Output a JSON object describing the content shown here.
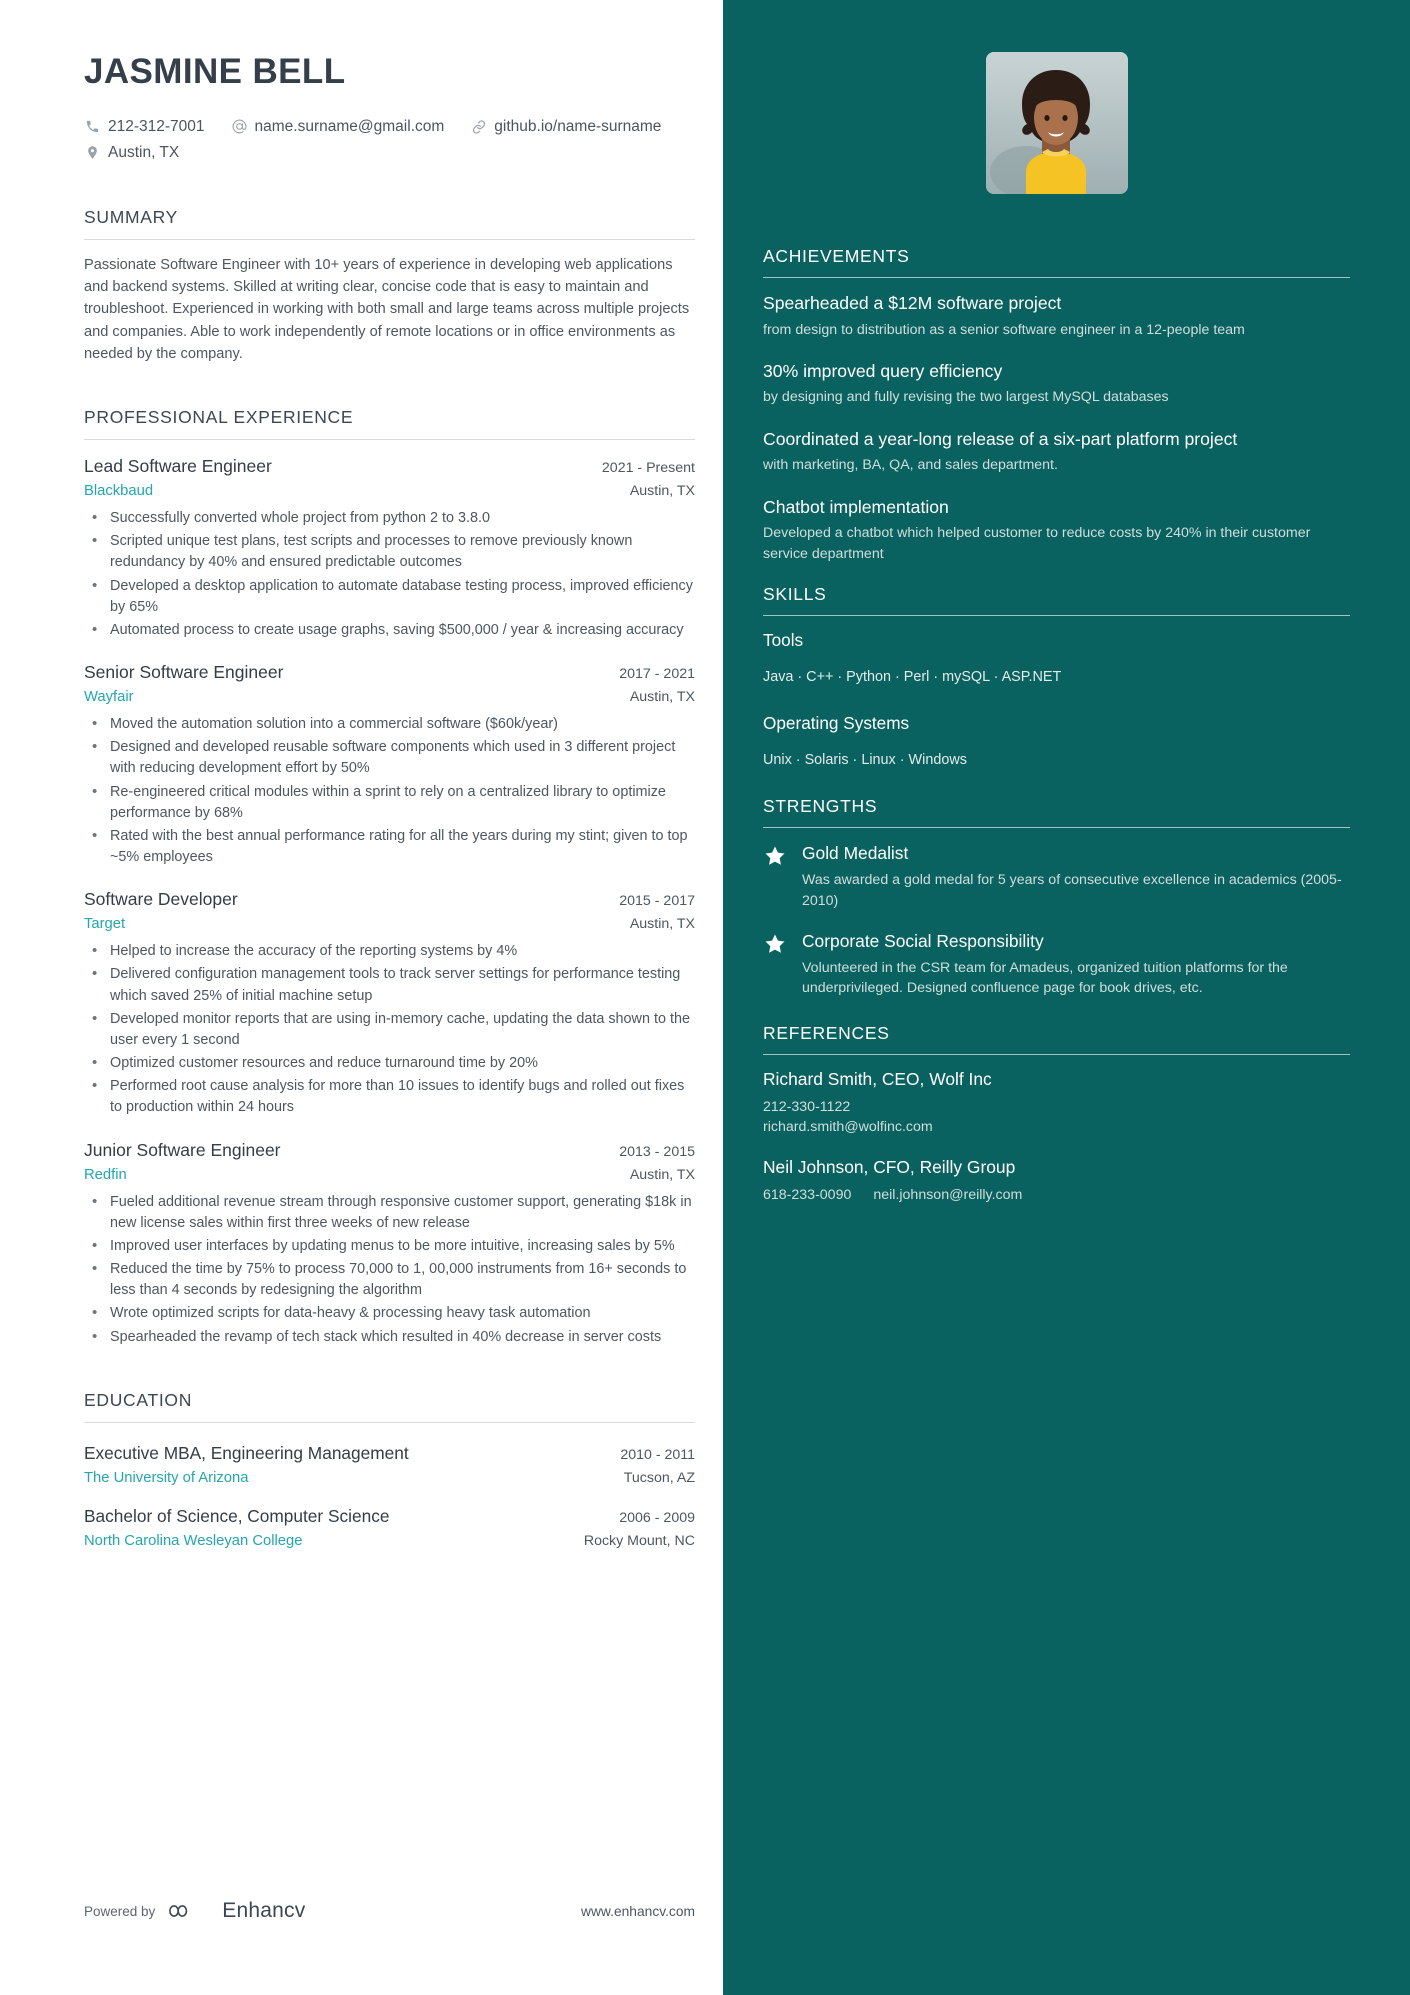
{
  "header": {
    "name": "JASMINE BELL",
    "contacts": [
      {
        "icon": "phone-icon",
        "text": "212-312-7001"
      },
      {
        "icon": "at-icon",
        "text": "name.surname@gmail.com"
      },
      {
        "icon": "link-icon",
        "text": "github.io/name-surname"
      }
    ],
    "location_icon": "map-pin-icon",
    "location": "Austin, TX"
  },
  "summary": {
    "title": "SUMMARY",
    "text": "Passionate Software Engineer with 10+ years of experience in developing web applications and backend systems. Skilled at writing clear, concise code that is easy to maintain and troubleshoot. Experienced in working with both small and large teams across multiple projects and companies. Able to work independently of remote locations or in office environments as needed by the company."
  },
  "experience": {
    "title": "PROFESSIONAL EXPERIENCE",
    "jobs": [
      {
        "title": "Lead Software Engineer",
        "dates": "2021 - Present",
        "company": "Blackbaud",
        "location": "Austin, TX",
        "bullets": [
          "Successfully converted whole project from python 2 to 3.8.0",
          "Scripted unique test plans, test scripts and processes to remove previously known redundancy by 40% and ensured predictable outcomes",
          "Developed a desktop application to automate database testing process, improved efficiency by 65%",
          "Automated process to create usage graphs, saving $500,000 / year & increasing accuracy"
        ]
      },
      {
        "title": "Senior Software Engineer",
        "dates": "2017 - 2021",
        "company": "Wayfair",
        "location": "Austin, TX",
        "bullets": [
          "Moved the automation solution into a commercial software ($60k/year)",
          "Designed and developed reusable software components which used in 3 different project with reducing development effort by 50%",
          "Re-engineered critical modules within a sprint to rely on a centralized library to optimize performance by 68%",
          "Rated with the best annual performance rating for all the years during my stint; given to top ~5% employees"
        ]
      },
      {
        "title": "Software Developer",
        "dates": "2015 - 2017",
        "company": "Target",
        "location": "Austin, TX",
        "bullets": [
          "Helped to increase the accuracy of the reporting systems by 4%",
          "Delivered configuration management tools to track server settings for performance testing which saved 25% of initial machine setup",
          "Developed monitor reports that are using in-memory cache, updating the data shown to the user every 1 second",
          "Optimized customer resources and reduce turnaround time by 20%",
          "Performed root cause analysis for more than 10 issues to identify bugs and rolled out fixes to production within 24 hours"
        ]
      },
      {
        "title": "Junior Software Engineer",
        "dates": "2013 - 2015",
        "company": "Redfin",
        "location": "Austin, TX",
        "bullets": [
          "Fueled additional revenue stream through responsive customer support, generating $18k in new license sales within first three weeks of new release",
          "Improved user interfaces by updating menus to be more intuitive, increasing sales by 5%",
          "Reduced the time by 75% to process 70,000 to 1, 00,000 instruments from 16+ seconds to less than 4 seconds by redesigning the algorithm",
          "Wrote optimized scripts for data-heavy & processing heavy task automation",
          "Spearheaded the revamp of tech stack which resulted in 40% decrease in server costs"
        ]
      }
    ]
  },
  "education": {
    "title": "EDUCATION",
    "items": [
      {
        "degree": "Executive MBA, Engineering Management",
        "dates": "2010 - 2011",
        "school": "The University of Arizona",
        "location": "Tucson, AZ"
      },
      {
        "degree": "Bachelor of Science, Computer Science",
        "dates": "2006 - 2009",
        "school": "North Carolina Wesleyan College",
        "location": "Rocky Mount, NC"
      }
    ]
  },
  "footer": {
    "powered_by": "Powered by",
    "brand": "Enhancv",
    "website": "www.enhancv.com"
  },
  "achievements": {
    "title": "ACHIEVEMENTS",
    "items": [
      {
        "title": "Spearheaded a $12M software project",
        "desc": "from design to distribution as a senior software engineer in a 12-people team"
      },
      {
        "title": "30% improved query efficiency",
        "desc": "by designing and fully revising the two largest MySQL databases"
      },
      {
        "title": "Coordinated a year-long release of a six-part platform project",
        "desc": "with marketing, BA, QA, and sales department."
      },
      {
        "title": "Chatbot implementation",
        "desc": "Developed a chatbot which helped customer to reduce costs by 240% in their customer service department"
      }
    ]
  },
  "skills": {
    "title": "SKILLS",
    "groups": [
      {
        "name": "Tools",
        "items": "Java · C++ · Python · Perl · mySQL · ASP.NET"
      },
      {
        "name": "Operating Systems",
        "items": "Unix ·  Solaris · Linux ·  Windows"
      }
    ]
  },
  "strengths": {
    "title": "STRENGTHS",
    "items": [
      {
        "icon": "star-icon",
        "title": "Gold Medalist",
        "desc": "Was awarded a gold medal for 5 years of consecutive excellence in academics (2005-2010)"
      },
      {
        "icon": "star-icon",
        "title": "Corporate Social Responsibility",
        "desc": "Volunteered in the CSR team for Amadeus, organized tuition platforms for the underprivileged. Designed confluence page for book drives, etc."
      }
    ]
  },
  "references": {
    "title": "REFERENCES",
    "items": [
      {
        "name": "Richard Smith, CEO, Wolf Inc",
        "phone": "212-330-1122",
        "email": "richard.smith@wolfinc.com",
        "inline": false
      },
      {
        "name": "Neil Johnson, CFO, Reilly Group",
        "phone": "618-233-0090",
        "email": "neil.johnson@reilly.com",
        "inline": true
      }
    ]
  },
  "colors": {
    "sidebar": "#0a6260",
    "accent": "#23a6ae",
    "heading": "#3c4751"
  }
}
